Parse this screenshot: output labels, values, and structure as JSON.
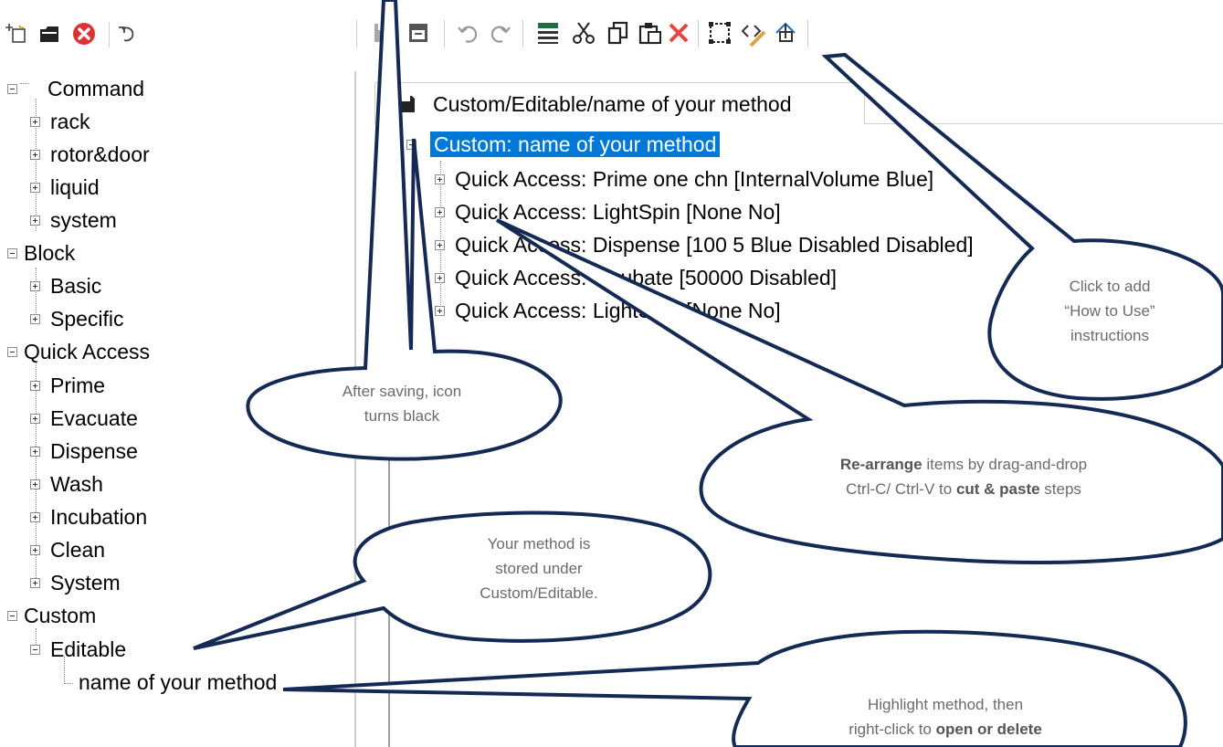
{
  "left_toolbar": {
    "icons": [
      "new-icon",
      "open-icon",
      "delete-icon",
      "import-icon"
    ]
  },
  "main_toolbar": {
    "icons": [
      "save-icon",
      "save-as-icon",
      "undo-icon",
      "redo-icon",
      "properties-icon",
      "cut-icon",
      "copy-icon",
      "paste-icon",
      "delete-step-icon",
      "select-icon",
      "how-to-use-icon",
      "export-icon"
    ]
  },
  "left_tree": {
    "items": [
      {
        "label": "Command"
      },
      {
        "label": "rack"
      },
      {
        "label": "rotor&door"
      },
      {
        "label": "liquid"
      },
      {
        "label": "system"
      },
      {
        "label": "Block"
      },
      {
        "label": "Basic"
      },
      {
        "label": "Specific"
      },
      {
        "label": "Quick Access"
      },
      {
        "label": "Prime"
      },
      {
        "label": "Evacuate"
      },
      {
        "label": "Dispense"
      },
      {
        "label": "Wash"
      },
      {
        "label": "Incubation"
      },
      {
        "label": "Clean"
      },
      {
        "label": "System"
      },
      {
        "label": "Custom"
      },
      {
        "label": "Editable"
      },
      {
        "label": "name of your method"
      }
    ]
  },
  "tab": {
    "label": "Custom/Editable/name of your method"
  },
  "method_tree": {
    "root": "Custom: name of your method",
    "steps": [
      "Quick Access: Prime one chn [InternalVolume Blue]",
      "Quick Access: LightSpin [None No]",
      "Quick Access: Dispense [100 5 Blue Disabled Disabled]",
      "Quick Access: Incubate [50000 Disabled]",
      "Quick Access: LightSpin [None No]"
    ]
  },
  "callouts": {
    "save": {
      "line1": "After saving, icon",
      "line2": "turns black"
    },
    "how_to_use": {
      "line1": "Click to add",
      "line2": "“How to Use”",
      "line3": "instructions"
    },
    "rearrange": {
      "bold1": "Re-arrange",
      "text1": " items by drag-and-drop",
      "text2": "Ctrl-C/ Ctrl-V to ",
      "bold2": "cut & paste",
      "text3": " steps"
    },
    "storage": {
      "line1": "Your method is",
      "line2": "stored under",
      "line3": "Custom/Editable."
    },
    "open_delete": {
      "line1": "Highlight method, then",
      "text1": "right-click to ",
      "bold1": "open or delete"
    }
  },
  "colors": {
    "selection": "#0078d7",
    "callout_stroke": "#142a55",
    "callout_text": "#6b6b6b"
  }
}
